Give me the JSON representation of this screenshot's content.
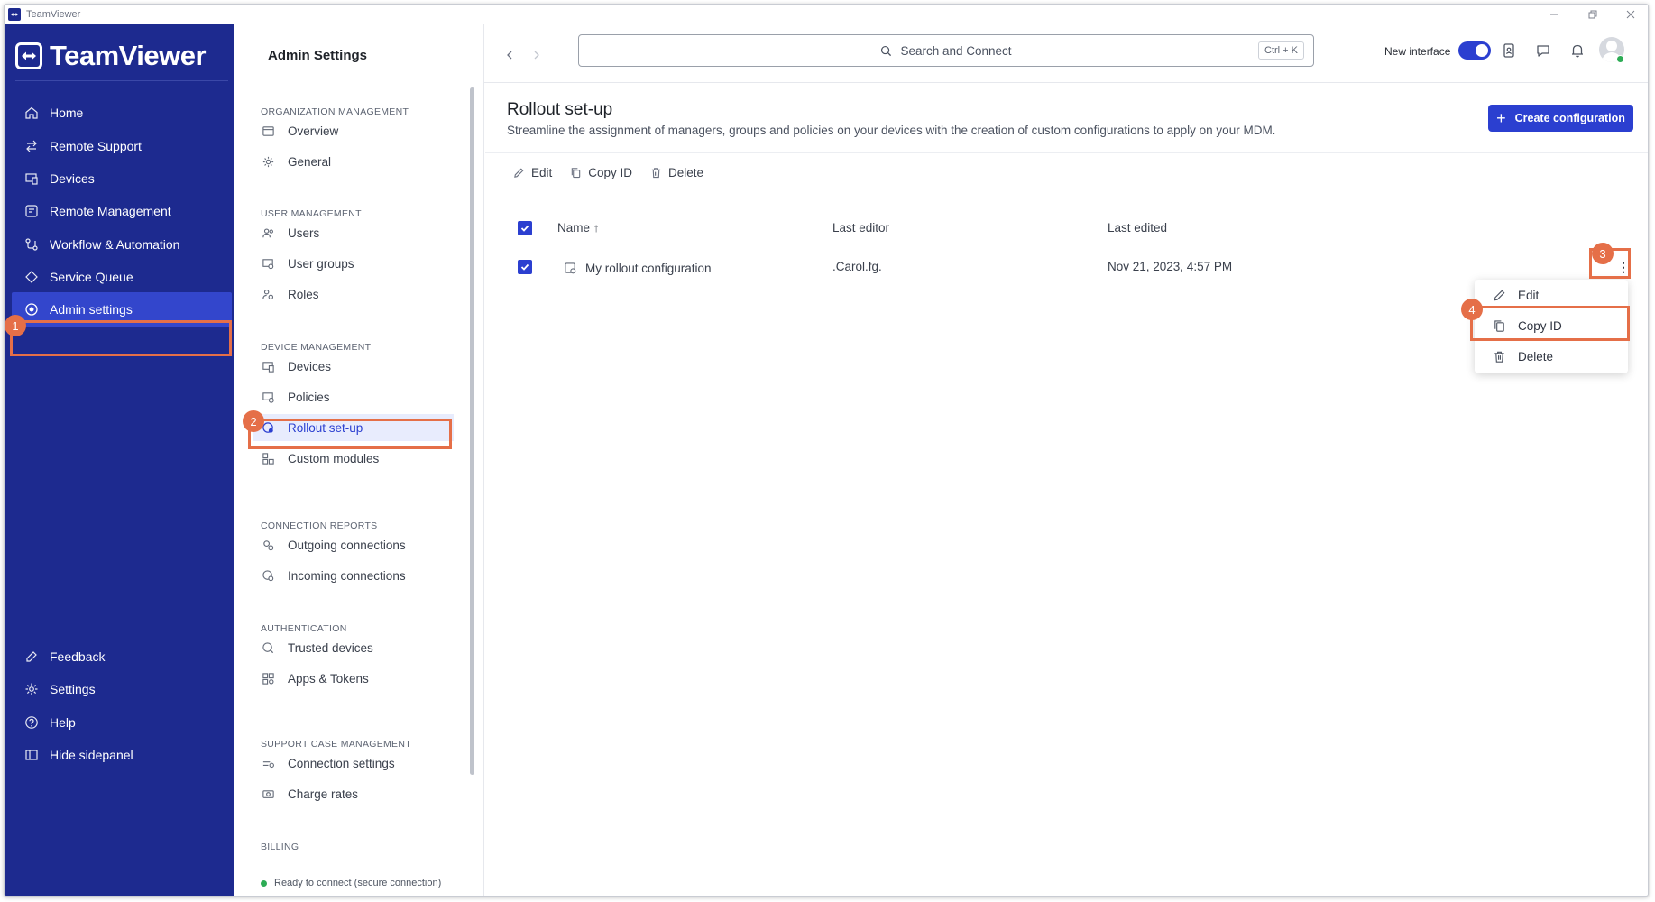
{
  "window": {
    "title": "TeamViewer"
  },
  "brand": {
    "name": "TeamViewer",
    "sidebar_color": "#1d2a8f",
    "accent": "#2b3fd0",
    "highlight": "#e56f48"
  },
  "sidebar": {
    "items": [
      {
        "label": "Home",
        "icon": "home-icon"
      },
      {
        "label": "Remote Support",
        "icon": "arrows-swap-icon"
      },
      {
        "label": "Devices",
        "icon": "devices-icon"
      },
      {
        "label": "Remote Management",
        "icon": "remote-management-icon"
      },
      {
        "label": "Workflow & Automation",
        "icon": "workflow-icon"
      },
      {
        "label": "Service Queue",
        "icon": "diamond-icon"
      },
      {
        "label": "Admin settings",
        "icon": "admin-gear-icon",
        "active": true
      }
    ],
    "bottom_items": [
      {
        "label": "Feedback",
        "icon": "feedback-icon"
      },
      {
        "label": "Settings",
        "icon": "gear-icon"
      },
      {
        "label": "Help",
        "icon": "help-icon"
      },
      {
        "label": "Hide sidepanel",
        "icon": "sidepanel-icon"
      }
    ]
  },
  "settings_panel": {
    "title": "Admin Settings",
    "sections": [
      {
        "heading": "ORGANIZATION MANAGEMENT",
        "items": [
          "Overview",
          "General"
        ]
      },
      {
        "heading": "USER MANAGEMENT",
        "items": [
          "Users",
          "User groups",
          "Roles"
        ]
      },
      {
        "heading": "DEVICE MANAGEMENT",
        "items": [
          "Devices",
          "Policies",
          "Rollout set-up",
          "Custom modules"
        ]
      },
      {
        "heading": "CONNECTION REPORTS",
        "items": [
          "Outgoing connections",
          "Incoming connections"
        ]
      },
      {
        "heading": "AUTHENTICATION",
        "items": [
          "Trusted devices",
          "Apps & Tokens"
        ]
      },
      {
        "heading": "SUPPORT CASE MANAGEMENT",
        "items": [
          "Connection settings",
          "Charge rates"
        ]
      },
      {
        "heading": "BILLING",
        "items": []
      }
    ],
    "active_item": "Rollout set-up",
    "status": "Ready to connect (secure connection)"
  },
  "header": {
    "search_placeholder": "Search and Connect",
    "shortcut": "Ctrl + K",
    "new_interface_label": "New interface",
    "new_interface_on": true
  },
  "main": {
    "title": "Rollout set-up",
    "subtitle": "Streamline the assignment of managers, groups and policies on your devices with the creation of custom configurations to apply on your MDM.",
    "create_button": "Create configuration",
    "toolbar": {
      "edit": "Edit",
      "copy_id": "Copy ID",
      "delete": "Delete"
    },
    "table": {
      "columns": [
        "Name ↑",
        "Last editor",
        "Last edited"
      ],
      "rows": [
        {
          "name": "My rollout configuration",
          "editor": ".Carol.fg.",
          "edited": "Nov 21, 2023, 4:57 PM",
          "selected": true
        }
      ]
    },
    "row_menu_glyph": "⋮",
    "context_menu": {
      "edit": "Edit",
      "copy_id": "Copy ID",
      "delete": "Delete"
    }
  },
  "callouts": [
    "1",
    "2",
    "3",
    "4"
  ]
}
